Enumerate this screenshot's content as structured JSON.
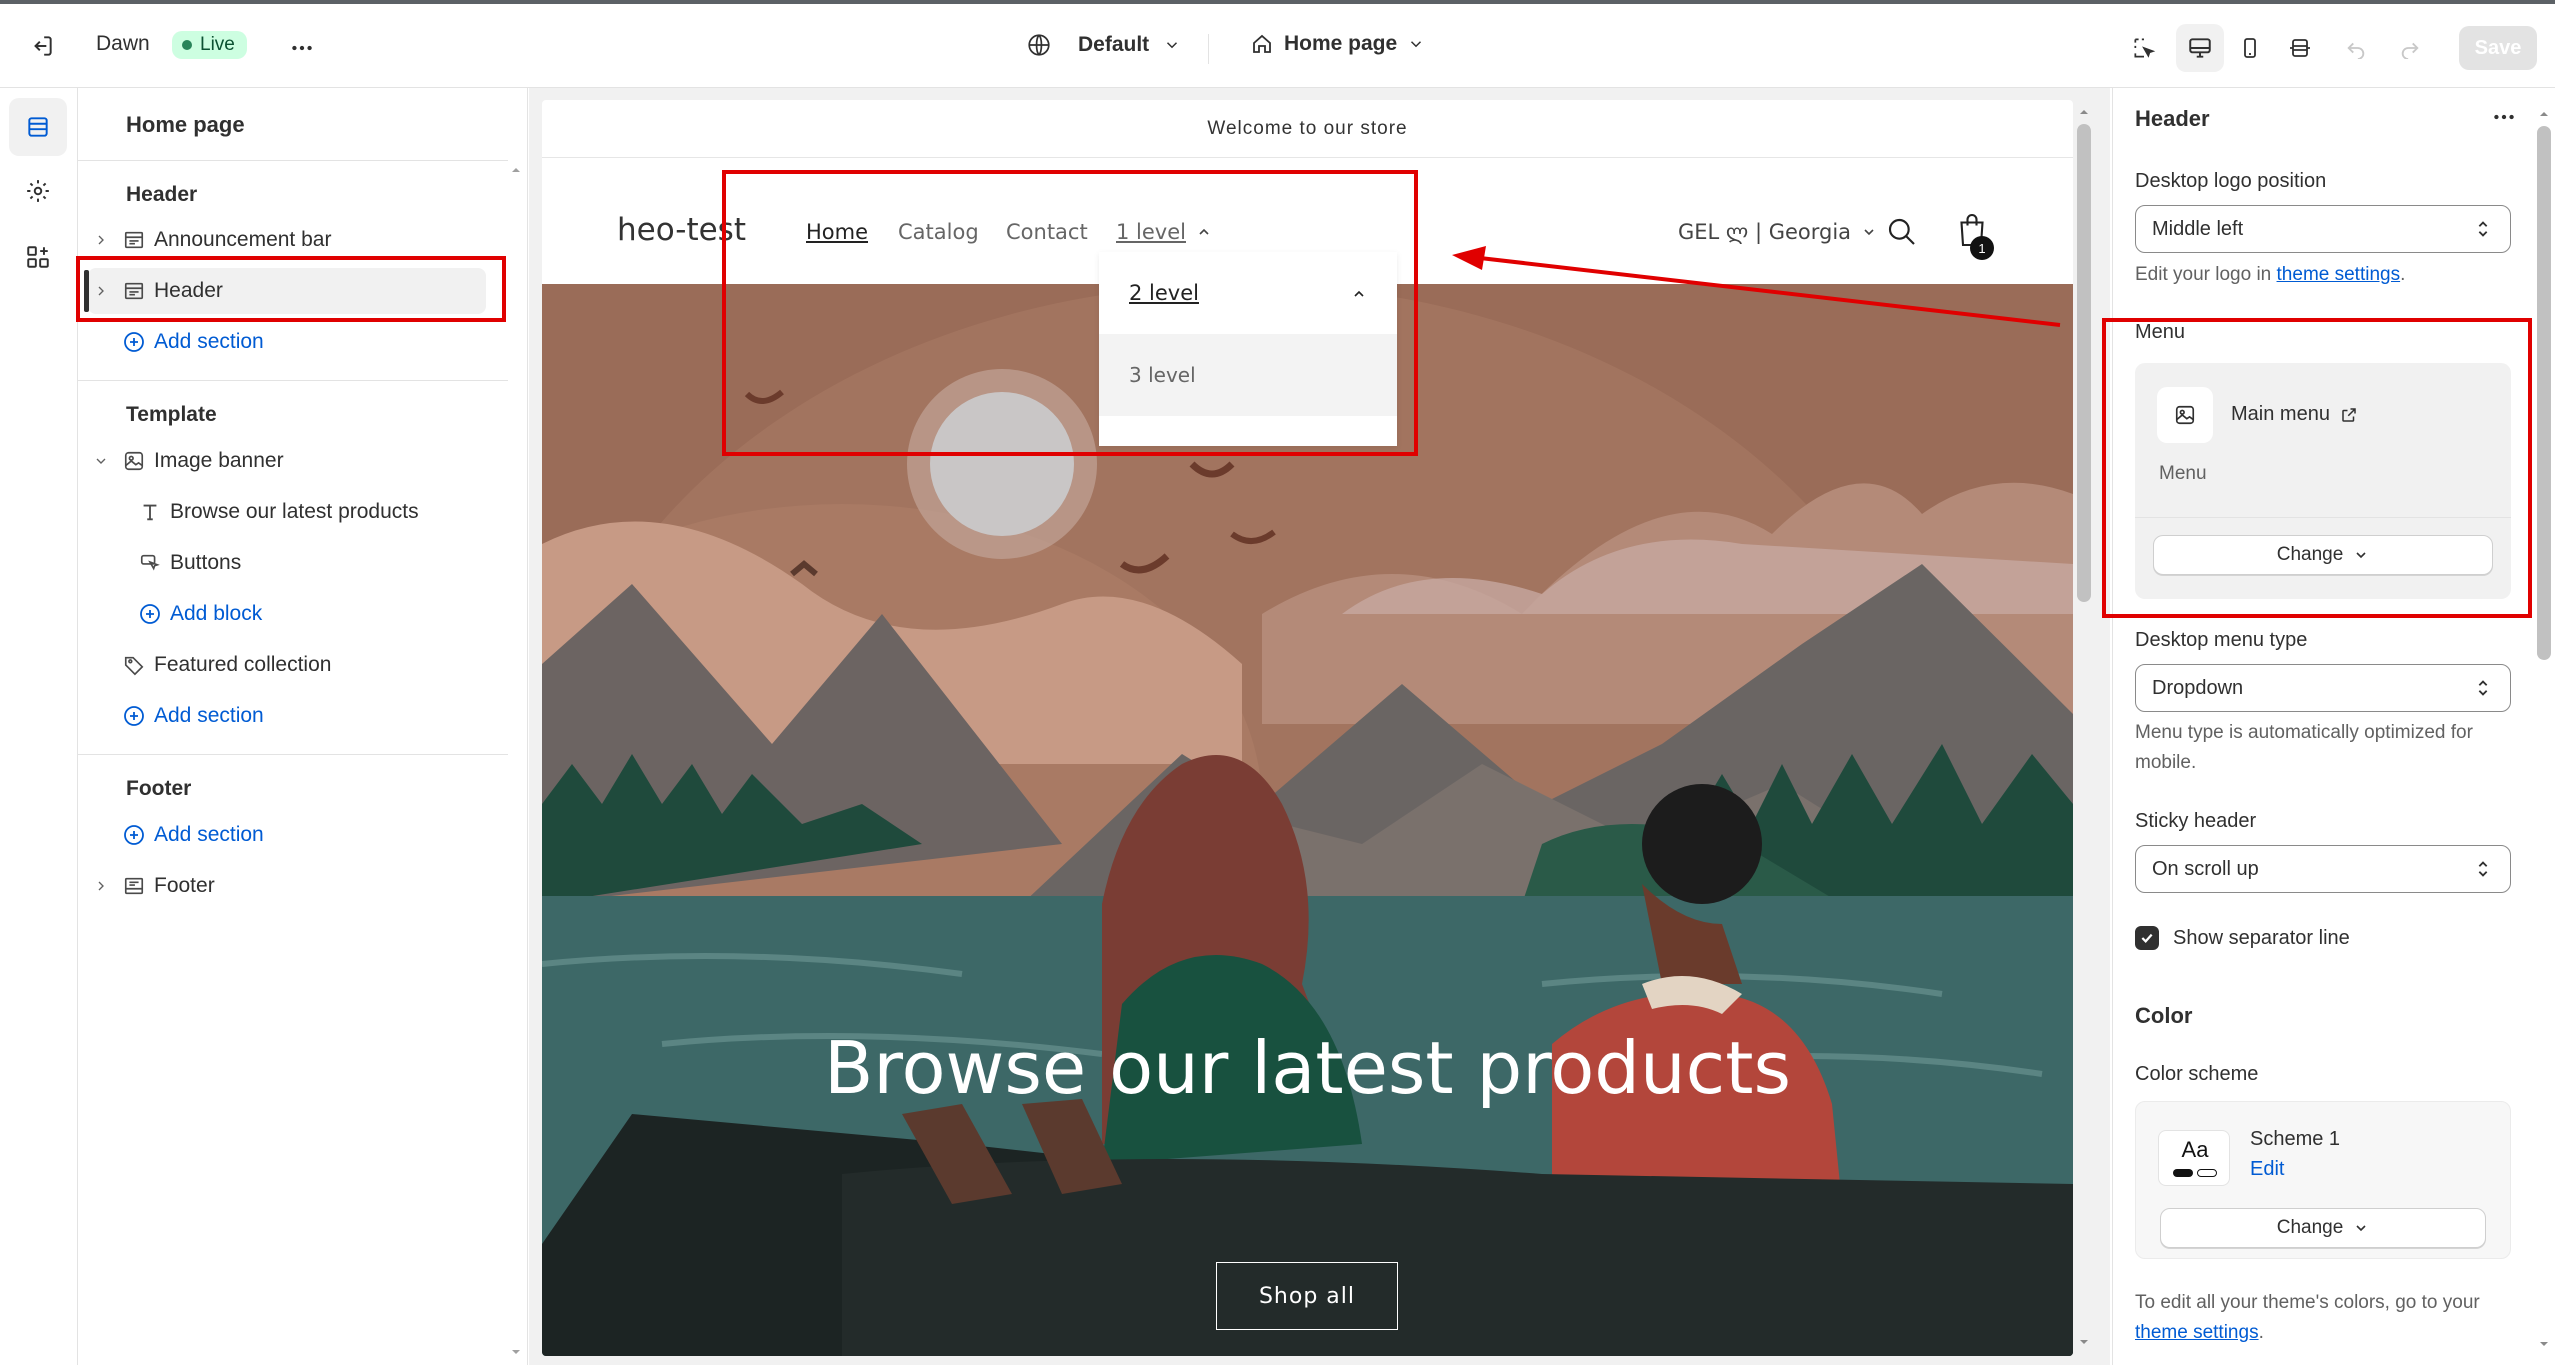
{
  "topbar": {
    "theme_name": "Dawn",
    "live_badge": "Live",
    "more_icon": "more-horizontal-icon",
    "language": "Default",
    "page": "Home page"
  },
  "toolbar": {
    "save_label": "Save",
    "icons": [
      "inspector-icon",
      "desktop-icon",
      "mobile-icon",
      "fullwidth-icon",
      "undo-icon",
      "redo-icon"
    ]
  },
  "sidebar": {
    "title": "Home page",
    "header_group": "Header",
    "header_items": [
      "Announcement bar",
      "Header"
    ],
    "add_section": "Add section",
    "template_group": "Template",
    "template_items": {
      "image_banner": "Image banner",
      "browse": "Browse our latest products",
      "buttons": "Buttons",
      "add_block": "Add block",
      "featured": "Featured collection"
    },
    "footer_group": "Footer",
    "footer_item": "Footer"
  },
  "preview": {
    "announcement": "Welcome to our store",
    "logo": "heo-test",
    "nav": [
      "Home",
      "Catalog",
      "Contact",
      "1 level"
    ],
    "currency": "GEL ლ | Georgia",
    "cart_count": "1",
    "dropdown": {
      "level2": "2 level",
      "level3": "3 level"
    },
    "banner_heading": "Browse our latest products",
    "banner_button": "Shop all"
  },
  "settings": {
    "title": "Header",
    "logo_position_label": "Desktop logo position",
    "logo_position_value": "Middle left",
    "logo_help_prefix": "Edit your logo in ",
    "logo_help_link": "theme settings",
    "logo_help_suffix": ".",
    "menu_label": "Menu",
    "menu_name": "Main menu",
    "menu_sub": "Menu",
    "change": "Change",
    "menu_type_label": "Desktop menu type",
    "menu_type_value": "Dropdown",
    "menu_type_help": "Menu type is automatically optimized for mobile.",
    "sticky_label": "Sticky header",
    "sticky_value": "On scroll up",
    "separator_label": "Show separator line",
    "separator_checked": true,
    "color_title": "Color",
    "scheme_label": "Color scheme",
    "scheme_name": "Scheme 1",
    "scheme_edit": "Edit",
    "scheme_swatch": "Aa",
    "colors_help_prefix": "To edit all your theme's colors, go to your",
    "colors_help_link": "theme settings",
    "colors_help_suffix": "."
  },
  "colors": {
    "accent": "#005bd3",
    "annotation": "#e00000",
    "live_bg": "#cdfee1"
  }
}
